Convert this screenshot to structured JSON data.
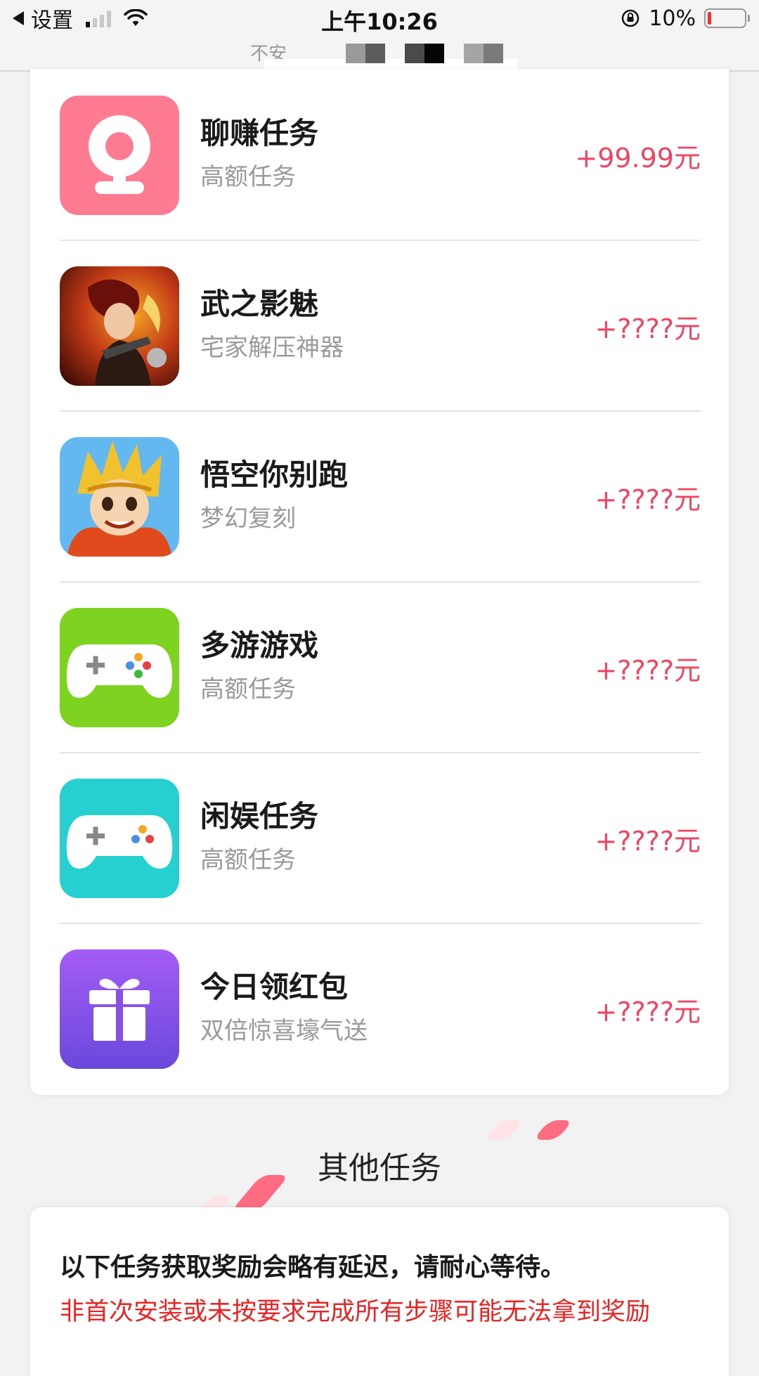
{
  "status_bar": {
    "back_label": "设置",
    "time": "上午10:26",
    "battery_percent": "10%",
    "battery_level": 0.1
  },
  "url_bar": {
    "partial_text": "不安"
  },
  "tasks": [
    {
      "title": "聊赚任务",
      "subtitle": "高额任务",
      "reward": "+99.99元",
      "icon": "webcam-icon",
      "icon_color": "#fe7b92"
    },
    {
      "title": "武之影魅",
      "subtitle": "宅家解压神器",
      "reward": "+????元",
      "icon": "game-warrior-icon",
      "icon_color": "#8a1d12"
    },
    {
      "title": "悟空你别跑",
      "subtitle": "梦幻复刻",
      "reward": "+????元",
      "icon": "game-wukong-icon",
      "icon_color": "#e8b21c"
    },
    {
      "title": "多游游戏",
      "subtitle": "高额任务",
      "reward": "+????元",
      "icon": "gamepad-icon",
      "icon_color": "#7ed321"
    },
    {
      "title": "闲娱任务",
      "subtitle": "高额任务",
      "reward": "+????元",
      "icon": "gamepad-icon",
      "icon_color": "#26d0d0"
    },
    {
      "title": "今日领红包",
      "subtitle": "双倍惊喜壕气送",
      "reward": "+????元",
      "icon": "gift-icon",
      "icon_color": "#8a4fe8"
    }
  ],
  "other_tasks": {
    "title": "其他任务",
    "notice_primary": "以下任务获取奖励会略有延迟，请耐心等待。",
    "notice_warning": "非首次安装或未按要求完成所有步骤可能无法拿到奖励"
  },
  "colors": {
    "reward": "#ef4563",
    "warning": "#e82424",
    "accent_deco": "#ff6b81"
  }
}
